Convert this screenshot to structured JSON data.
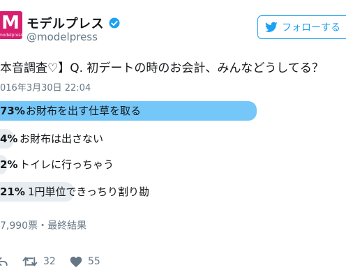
{
  "header": {
    "avatar_text": "M",
    "avatar_sub": "modelpress",
    "display_name": "モデルプレス",
    "handle": "@modelpress",
    "follow_label": "フォローする"
  },
  "tweet": {
    "text": "本音調査♡】Q. 初デートの時のお会計、みんなどうしてる？",
    "timestamp": "016年3月30日 22:04"
  },
  "poll": {
    "options": [
      {
        "pct": "73%",
        "label": "お財布を出す仕草を取る",
        "value": 73,
        "winner": true
      },
      {
        "pct": "4%",
        "label": "お財布は出さない",
        "value": 4,
        "winner": false
      },
      {
        "pct": "2%",
        "label": "トイレに行っちゃう",
        "value": 2,
        "winner": false
      },
      {
        "pct": "21%",
        "label": "1円単位できっちり割り勘",
        "value": 21,
        "winner": false
      }
    ],
    "meta": "7,990票・最終結果",
    "colors": {
      "winner": "#74c7f8",
      "other": "#e6ecf0"
    }
  },
  "actions": {
    "reply_icon": "reply-icon",
    "retweet_count": "32",
    "like_count": "55"
  }
}
